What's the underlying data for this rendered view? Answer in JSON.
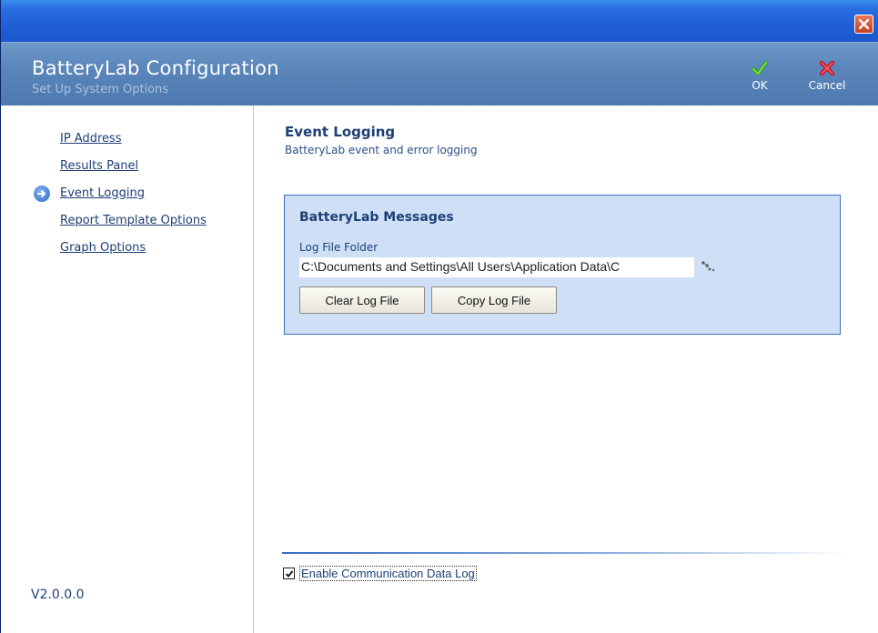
{
  "window": {
    "close_icon": "close-icon"
  },
  "header": {
    "title": "BatteryLab Configuration",
    "subtitle": "Set Up System Options",
    "ok_label": "OK",
    "cancel_label": "Cancel"
  },
  "sidebar": {
    "items": [
      {
        "label": "IP Address",
        "active": false
      },
      {
        "label": "Results Panel",
        "active": false
      },
      {
        "label": "Event Logging",
        "active": true
      },
      {
        "label": "Report Template Options",
        "active": false
      },
      {
        "label": "Graph Options",
        "active": false
      }
    ],
    "version": "V2.0.0.0"
  },
  "main": {
    "title": "Event Logging",
    "subtitle": "BatteryLab event and error logging",
    "panel": {
      "title": "BatteryLab Messages",
      "field_label": "Log File Folder",
      "path_value": "C:\\Documents and Settings\\All Users\\Application Data\\C",
      "clear_button": "Clear Log File",
      "copy_button": "Copy Log File"
    },
    "checkbox": {
      "label": "Enable Communication Data Log",
      "checked": true
    }
  },
  "colors": {
    "titlebar": "#1f5fd6",
    "header": "#5b86ba",
    "panel_bg": "#cfe0f6",
    "link": "#1d3f75"
  }
}
